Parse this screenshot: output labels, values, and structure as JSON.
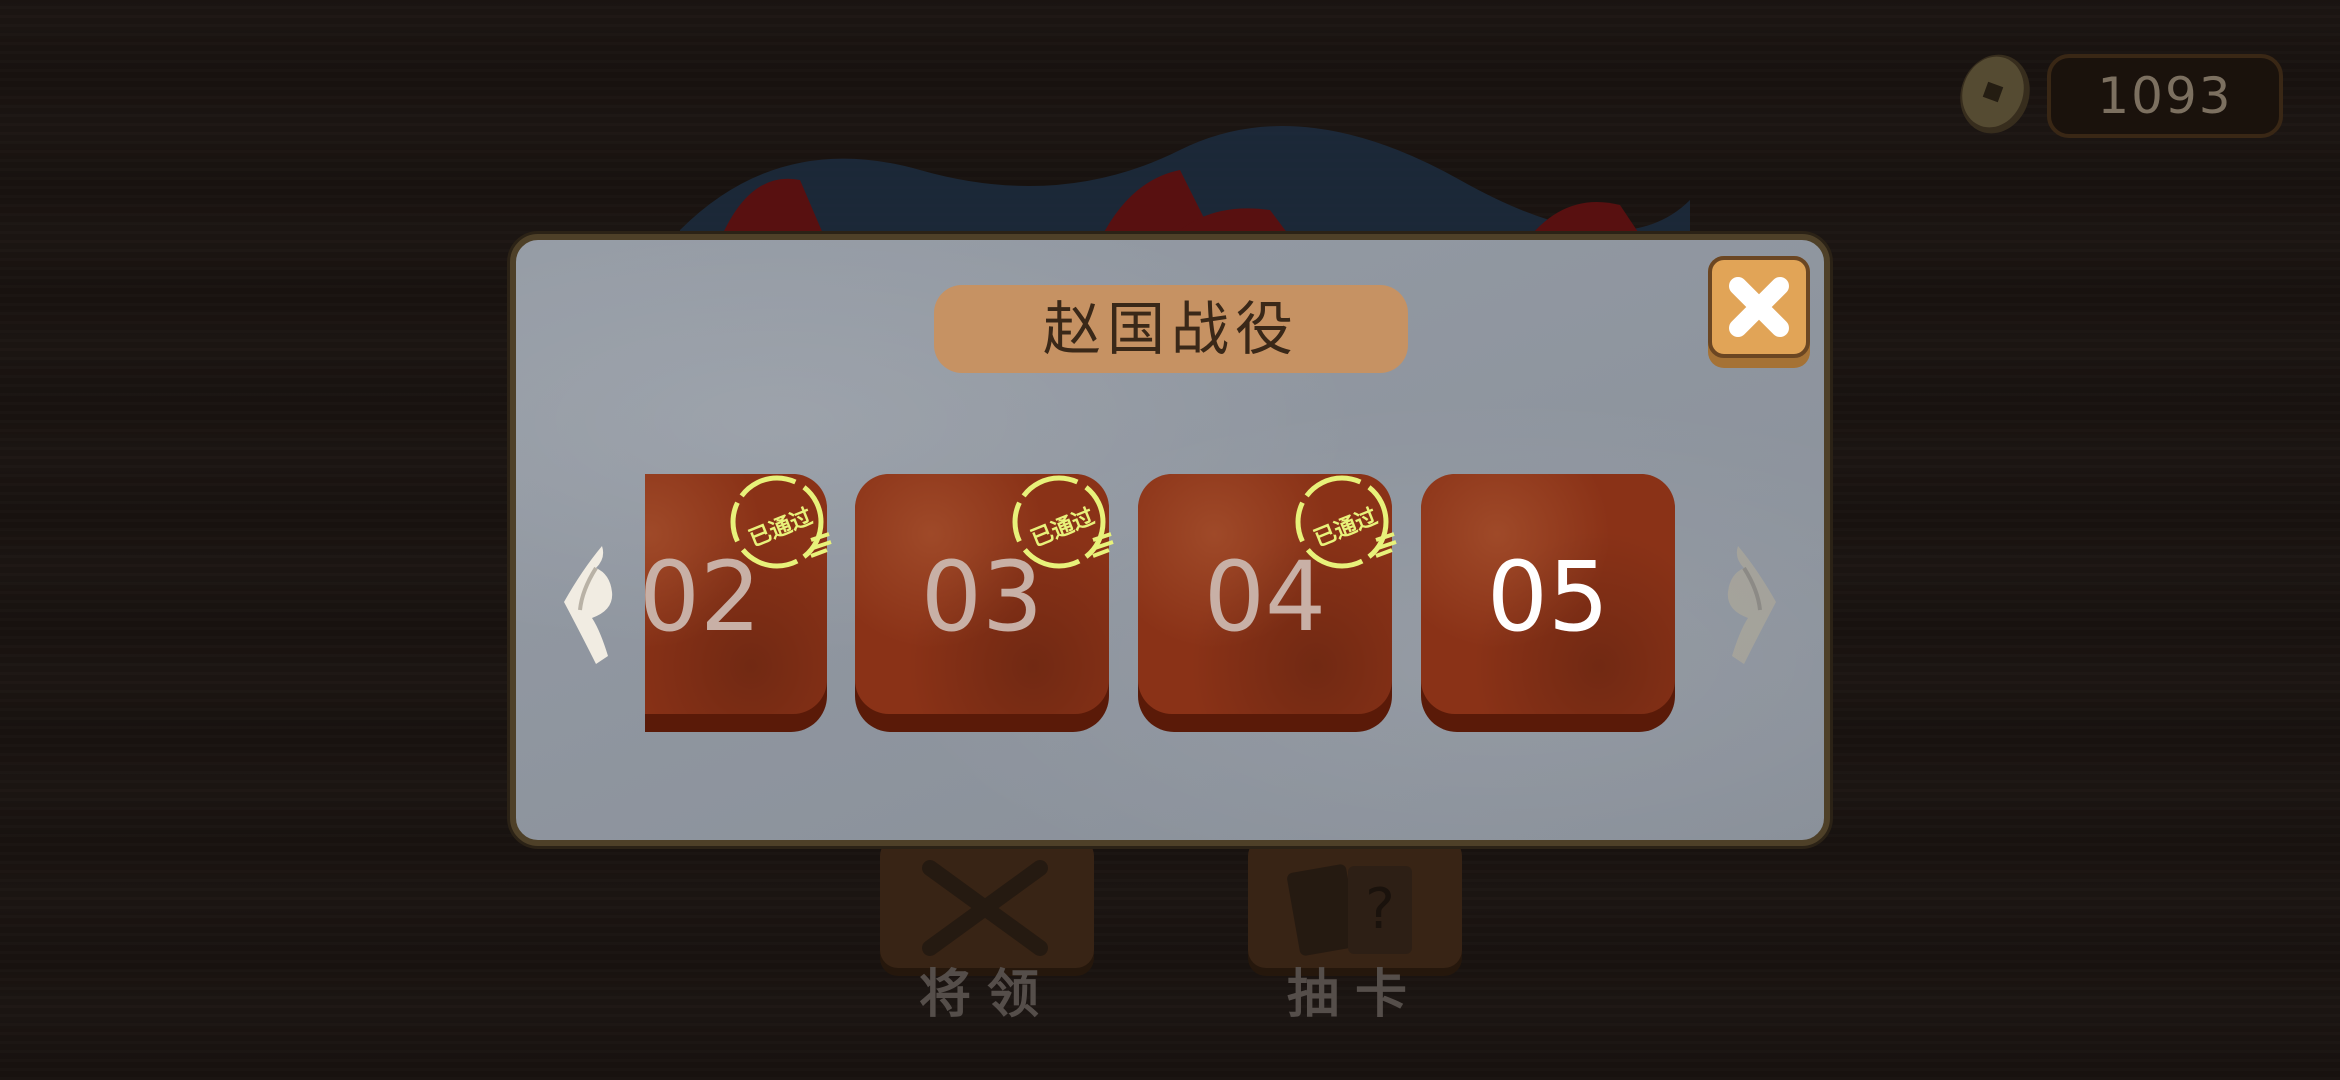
{
  "coins": {
    "value": "1093"
  },
  "dialog": {
    "title": "赵国战役",
    "close_icon": "close-x-icon",
    "levels": [
      {
        "label": "02",
        "status": "passed",
        "stamp": "已通过"
      },
      {
        "label": "03",
        "status": "passed",
        "stamp": "已通过"
      },
      {
        "label": "04",
        "status": "passed",
        "stamp": "已通过"
      },
      {
        "label": "05",
        "status": "current",
        "stamp": ""
      }
    ],
    "prev_icon": "scroll-left-arrow-icon",
    "next_icon": "scroll-right-arrow-icon"
  },
  "menu": {
    "generals_label": "将领",
    "draw_label": "抽卡"
  },
  "colors": {
    "tile": "#8a3217",
    "stamp": "#e8f27a",
    "title_pill": "#c69263",
    "close_button": "#e1a457"
  }
}
